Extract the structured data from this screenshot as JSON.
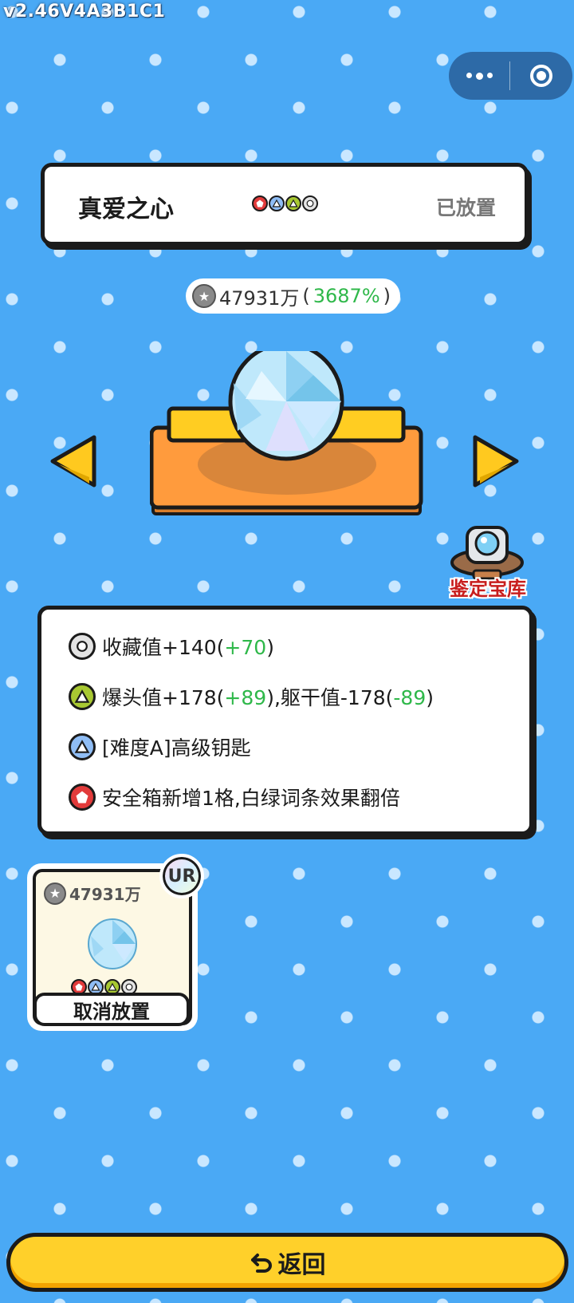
{
  "system": {
    "version": "v2.46V4A3B1C1"
  },
  "capsule": {
    "more_icon": "more-dots-icon",
    "close_icon": "target-circle-icon"
  },
  "item": {
    "name": "真爱之心",
    "status": "已放置",
    "gems": [
      "red-pentagon",
      "blue-triangle",
      "green-triangle",
      "white-circle"
    ],
    "value": "47931万",
    "value_open": "(",
    "value_pct": "3687%",
    "value_close": ")"
  },
  "vault": {
    "label": "鉴定宝库"
  },
  "stats": [
    {
      "gem": "white",
      "parts": [
        {
          "t": "收藏值+140("
        },
        {
          "t": "+70",
          "g": true
        },
        {
          "t": ")"
        }
      ]
    },
    {
      "gem": "green",
      "parts": [
        {
          "t": "爆头值+178("
        },
        {
          "t": "+89",
          "g": true
        },
        {
          "t": "),躯干值-178("
        },
        {
          "t": "-89",
          "g": true
        },
        {
          "t": ")"
        }
      ]
    },
    {
      "gem": "blue",
      "parts": [
        {
          "t": "[难度A]高级钥匙"
        }
      ]
    },
    {
      "gem": "red",
      "parts": [
        {
          "t": "安全箱新增1格,白绿词条效果翻倍"
        }
      ]
    }
  ],
  "slot_card": {
    "value": "47931万",
    "rarity": "UR",
    "cancel_label": "取消放置"
  },
  "footer": {
    "back_label": "返回"
  },
  "colors": {
    "accent_green": "#2fb84a",
    "back_yellow": "#ffd02a",
    "vault_red": "#c81e1e"
  }
}
